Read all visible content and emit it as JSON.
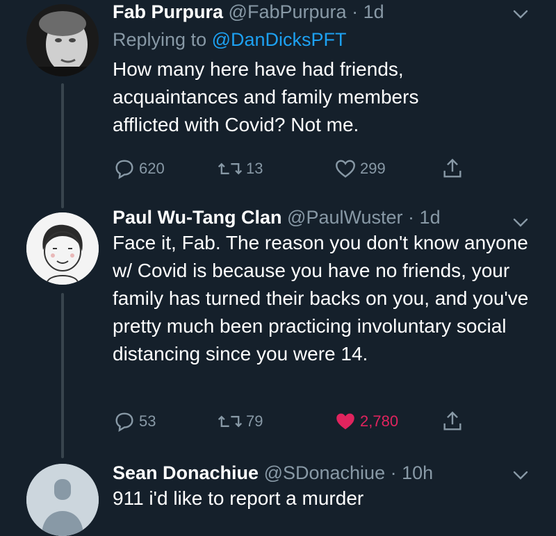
{
  "tweets": [
    {
      "name": "Fab Purpura",
      "handle": "@FabPurpura",
      "time": "1d",
      "replying_prefix": "Replying to",
      "replying_to": "@DanDicksPFT",
      "text": "How many here have had friends, acquaintances and family members afflicted with Covid?  Not me.",
      "replies": "620",
      "retweets": "13",
      "likes": "299",
      "liked": false
    },
    {
      "name": "Paul Wu-Tang Clan",
      "handle": "@PaulWuster",
      "time": "1d",
      "text": "Face it, Fab. The reason you don't know anyone w/ Covid is because you have no friends, your family has turned their backs on you, and you've pretty much been practicing involuntary social distancing since you were 14.",
      "replies": "53",
      "retweets": "79",
      "likes": "2,780",
      "liked": true
    },
    {
      "name": "Sean Donachiue",
      "handle": "@SDonachiue",
      "time": "10h",
      "text": "911 i'd like to report a murder"
    }
  ],
  "separator": "·",
  "colors": {
    "background": "#15202b",
    "secondary_text": "#8899a6",
    "link": "#1da1f2",
    "like": "#e0245e",
    "thread_line": "#38444d"
  },
  "icons": [
    "chevron-down-icon",
    "reply-icon",
    "retweet-icon",
    "like-icon",
    "share-icon",
    "default-avatar-icon"
  ]
}
